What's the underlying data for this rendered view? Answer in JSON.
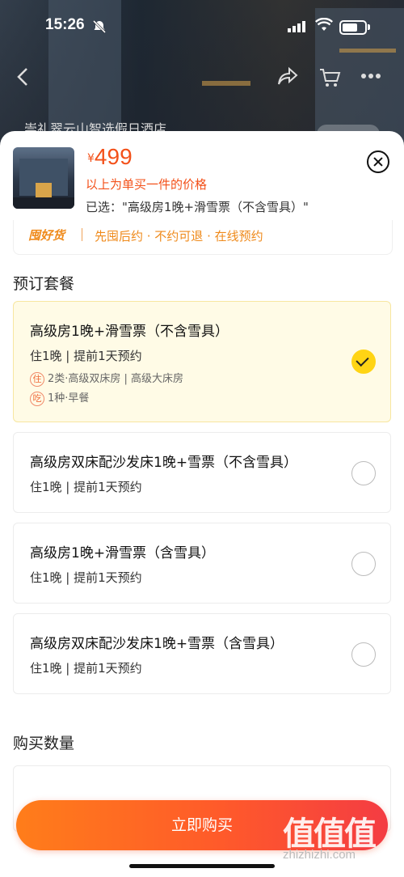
{
  "status_bar": {
    "time": "15:26"
  },
  "background": {
    "hotel_name": "崇礼翠云山智选假日酒店"
  },
  "product": {
    "currency": "¥",
    "price": "499",
    "price_note": "以上为单买一件的价格",
    "selected": "已选：\"高级房1晚+滑雪票（不含雪具）\""
  },
  "guarantee": {
    "logo": "囤好货",
    "text": "先囤后约 · 不约可退 · 在线预约"
  },
  "packages": {
    "title": "预订套餐",
    "items": [
      {
        "name": "高级房1晚+滑雪票（不含雪具）",
        "sub": "住1晚 | 提前1天预约",
        "tags": [
          {
            "icon": "住",
            "text": "2类·高级双床房 | 高级大床房"
          },
          {
            "icon": "吃",
            "text": "1种·早餐"
          }
        ],
        "selected": true
      },
      {
        "name": "高级房双床配沙发床1晚+雪票（不含雪具）",
        "sub": "住1晚 | 提前1天预约",
        "selected": false
      },
      {
        "name": "高级房1晚+滑雪票（含雪具）",
        "sub": "住1晚 | 提前1天预约",
        "selected": false
      },
      {
        "name": "高级房双床配沙发床1晚+雪票（含雪具）",
        "sub": "住1晚 | 提前1天预约",
        "selected": false
      }
    ]
  },
  "quantity": {
    "title": "购买数量"
  },
  "buy_button": {
    "label": "立即购买"
  },
  "watermark": {
    "text": "值值值",
    "url": "zhizhizhi.com"
  },
  "colors": {
    "accent": "#f3511a",
    "selected_bg": "#fffbe6",
    "check": "#ffd414",
    "button_start": "#ff7d1a",
    "button_end": "#f43c43"
  }
}
